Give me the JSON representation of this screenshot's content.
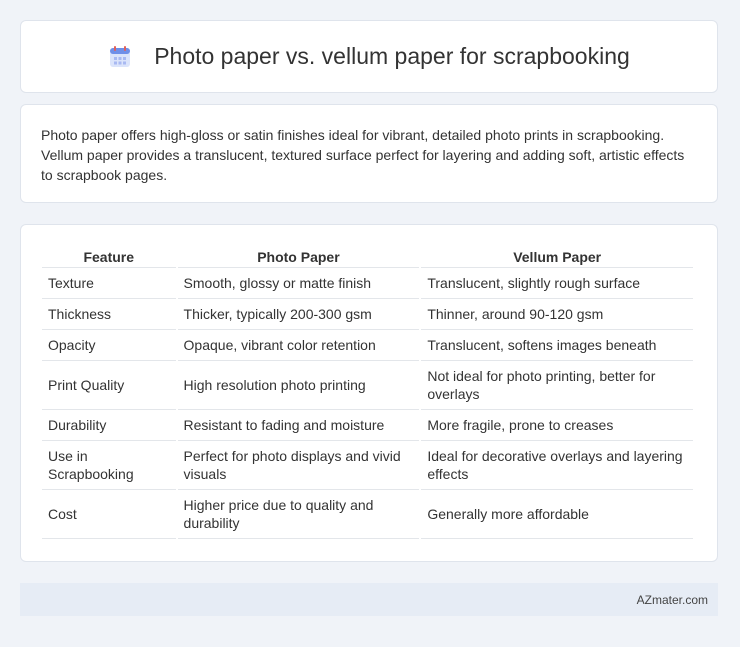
{
  "header": {
    "title": "Photo paper vs. vellum paper for scrapbooking",
    "icon": "calendar-icon"
  },
  "summary": {
    "text": "Photo paper offers high-gloss or satin finishes ideal for vibrant, detailed photo prints in scrapbooking. Vellum paper provides a translucent, textured surface perfect for layering and adding soft, artistic effects to scrapbook pages."
  },
  "table": {
    "headers": [
      "Feature",
      "Photo Paper",
      "Vellum Paper"
    ],
    "rows": [
      [
        "Texture",
        "Smooth, glossy or matte finish",
        "Translucent, slightly rough surface"
      ],
      [
        "Thickness",
        "Thicker, typically 200-300 gsm",
        "Thinner, around 90-120 gsm"
      ],
      [
        "Opacity",
        "Opaque, vibrant color retention",
        "Translucent, softens images beneath"
      ],
      [
        "Print Quality",
        "High resolution photo printing",
        "Not ideal for photo printing, better for overlays"
      ],
      [
        "Durability",
        "Resistant to fading and moisture",
        "More fragile, prone to creases"
      ],
      [
        "Use in Scrapbooking",
        "Perfect for photo displays and vivid visuals",
        "Ideal for decorative overlays and layering effects"
      ],
      [
        "Cost",
        "Higher price due to quality and durability",
        "Generally more affordable"
      ]
    ]
  },
  "footer": {
    "brand": "AZmater.com"
  },
  "colors": {
    "background": "#f0f3f8",
    "card": "#ffffff",
    "footer": "#e6ecf5",
    "icon_blue": "#6f8fe8",
    "icon_red": "#e0605a"
  }
}
